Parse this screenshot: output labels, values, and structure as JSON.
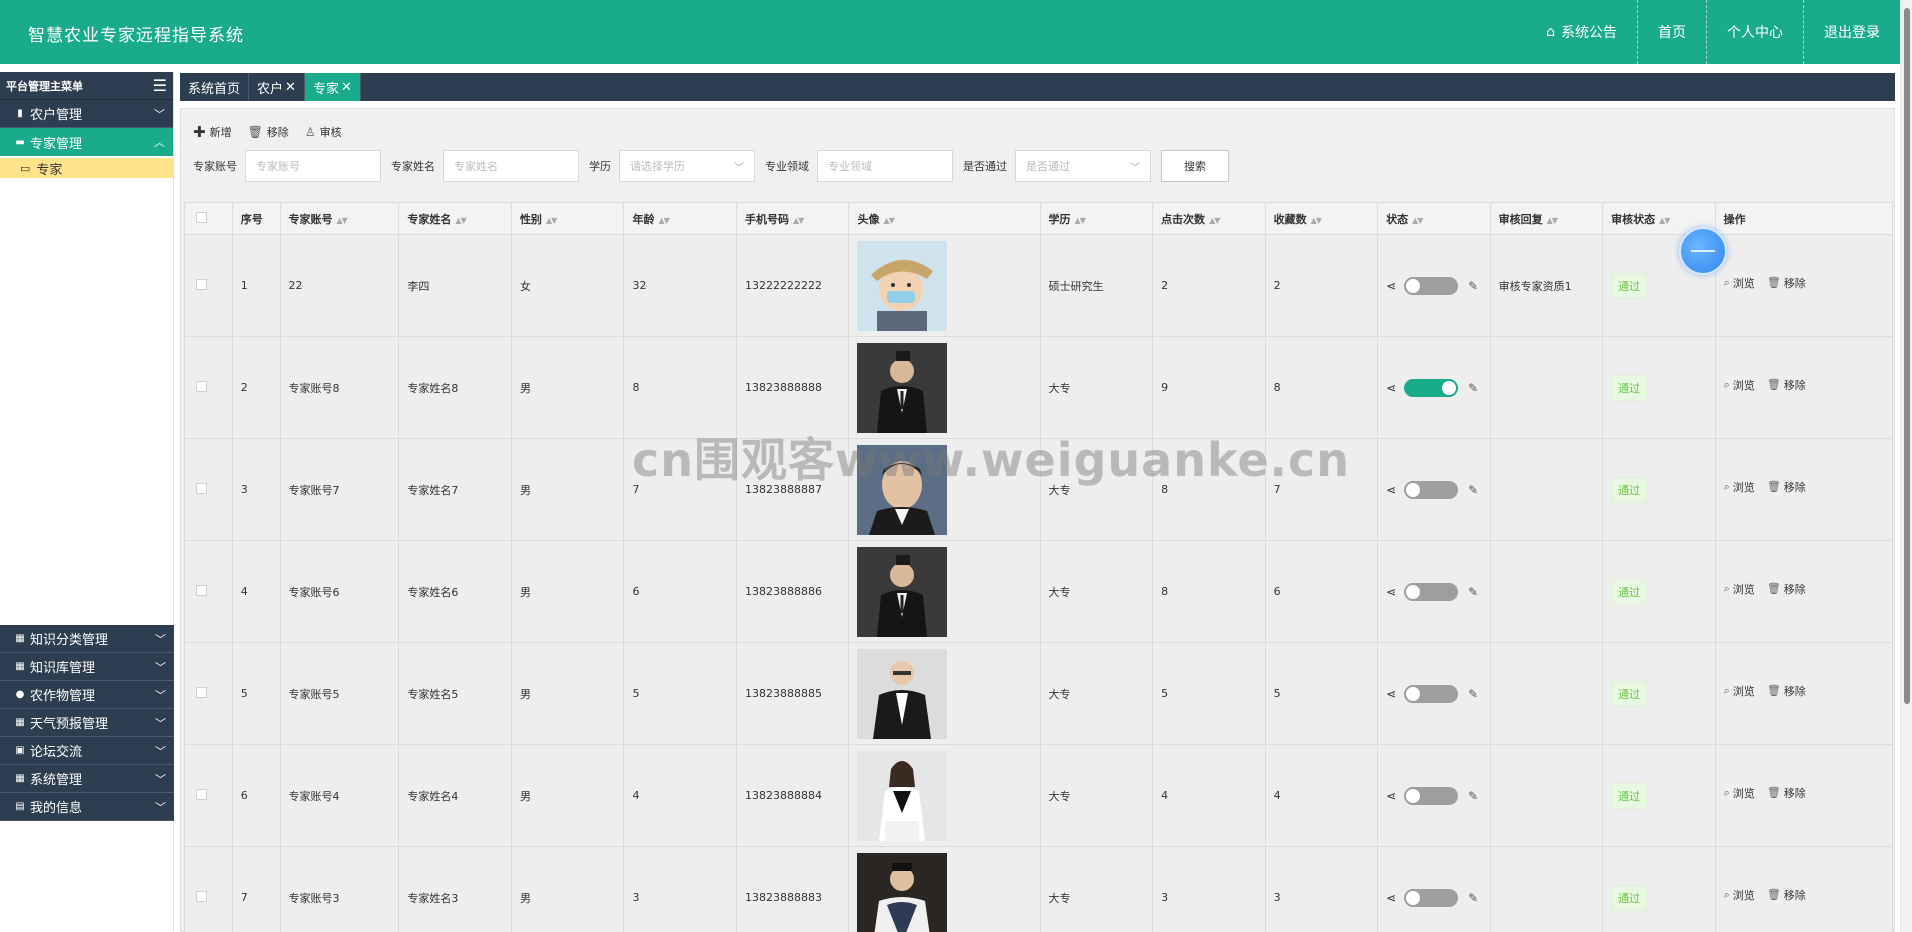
{
  "header": {
    "title": "智慧农业专家远程指导系统",
    "nav": [
      {
        "label": "系统公告",
        "icon": "home-icon"
      },
      {
        "label": "首页"
      },
      {
        "label": "个人中心"
      },
      {
        "label": "退出登录"
      }
    ]
  },
  "sidebar": {
    "heading": "平台管理主菜单",
    "items": [
      {
        "label": "农户管理",
        "icon": "clipboard-icon"
      },
      {
        "label": "专家管理",
        "icon": "monitor-icon",
        "active": true,
        "sub": [
          {
            "label": "专家",
            "icon": "folder-icon"
          }
        ]
      },
      {
        "label": "知识分类管理",
        "icon": "grid-icon"
      },
      {
        "label": "知识库管理",
        "icon": "grid-icon"
      },
      {
        "label": "农作物管理",
        "icon": "user-icon"
      },
      {
        "label": "天气预报管理",
        "icon": "grid-icon"
      },
      {
        "label": "论坛交流",
        "icon": "image-icon"
      },
      {
        "label": "系统管理",
        "icon": "grid-icon"
      },
      {
        "label": "我的信息",
        "icon": "card-icon"
      }
    ]
  },
  "tabs": [
    {
      "label": "系统首页"
    },
    {
      "label": "农户",
      "close": "✕"
    },
    {
      "label": "专家",
      "close": "✕",
      "active": true
    }
  ],
  "toolbar": {
    "add": "新增",
    "remove": "移除",
    "audit": "审核"
  },
  "search": {
    "account_label": "专家账号",
    "account_placeholder": "专家账号",
    "name_label": "专家姓名",
    "name_placeholder": "专家姓名",
    "edu_label": "学历",
    "edu_placeholder": "请选择学历",
    "field_label": "专业领域",
    "field_placeholder": "专业领域",
    "pass_label": "是否通过",
    "pass_placeholder": "是否通过",
    "button": "搜索"
  },
  "table": {
    "columns": [
      "序号",
      "专家账号",
      "专家姓名",
      "性别",
      "年龄",
      "手机号码",
      "头像",
      "学历",
      "点击次数",
      "收藏数",
      "状态",
      "审核回复",
      "审核状态",
      "操作"
    ],
    "view_label": "浏览",
    "delete_label": "移除",
    "rows": [
      {
        "no": "1",
        "account": "22",
        "name": "李四",
        "gender": "女",
        "age": "32",
        "phone": "13222222222",
        "avatar": "cartoon",
        "edu": "硕士研究生",
        "clicks": "2",
        "favs": "2",
        "status_on": false,
        "reply": "审核专家资质1",
        "audit": "通过"
      },
      {
        "no": "2",
        "account": "专家账号8",
        "name": "专家姓名8",
        "gender": "男",
        "age": "8",
        "phone": "13823888888",
        "avatar": "suit",
        "edu": "大专",
        "clicks": "9",
        "favs": "8",
        "status_on": true,
        "reply": "",
        "audit": "通过"
      },
      {
        "no": "3",
        "account": "专家账号7",
        "name": "专家姓名7",
        "gender": "男",
        "age": "7",
        "phone": "13823888887",
        "avatar": "face",
        "edu": "大专",
        "clicks": "8",
        "favs": "7",
        "status_on": false,
        "reply": "",
        "audit": "通过"
      },
      {
        "no": "4",
        "account": "专家账号6",
        "name": "专家姓名6",
        "gender": "男",
        "age": "6",
        "phone": "13823888886",
        "avatar": "suit",
        "edu": "大专",
        "clicks": "8",
        "favs": "6",
        "status_on": false,
        "reply": "",
        "audit": "通过"
      },
      {
        "no": "5",
        "account": "专家账号5",
        "name": "专家姓名5",
        "gender": "男",
        "age": "5",
        "phone": "13823888885",
        "avatar": "light",
        "edu": "大专",
        "clicks": "5",
        "favs": "5",
        "status_on": false,
        "reply": "",
        "audit": "通过"
      },
      {
        "no": "6",
        "account": "专家账号4",
        "name": "专家姓名4",
        "gender": "男",
        "age": "4",
        "phone": "13823888884",
        "avatar": "woman",
        "edu": "大专",
        "clicks": "4",
        "favs": "4",
        "status_on": false,
        "reply": "",
        "audit": "通过"
      },
      {
        "no": "7",
        "account": "专家账号3",
        "name": "专家姓名3",
        "gender": "男",
        "age": "3",
        "phone": "13823888883",
        "avatar": "vest",
        "edu": "大专",
        "clicks": "3",
        "favs": "3",
        "status_on": false,
        "reply": "",
        "audit": "通过"
      }
    ]
  },
  "watermark": "cn围观客www.weiguanke.cn",
  "colors": {
    "primary": "#1aaa8c",
    "dark_nav": "#2d3e50",
    "submenu_highlight": "#ffe38a",
    "badge_text": "#6cc24a"
  }
}
